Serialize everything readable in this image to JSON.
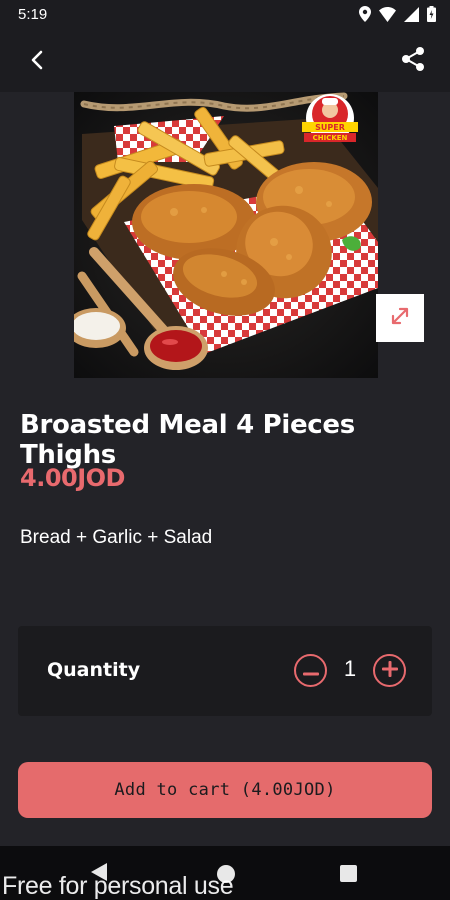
{
  "status_bar": {
    "time": "5:19"
  },
  "header": {
    "back_icon": "arrow-back-icon",
    "share_icon": "share-icon"
  },
  "product": {
    "title": "Broasted Meal 4 Pieces Thighs",
    "price": "4.00JOD",
    "description": "Bread + Garlic + Salad",
    "image_logo_text": [
      "SUPER",
      "CHICKEN"
    ],
    "expand_icon": "expand-icon"
  },
  "quantity": {
    "label": "Quantity",
    "value": "1"
  },
  "cart": {
    "button_label": "Add to cart (4.00JOD)"
  },
  "watermark": "Free for personal use",
  "colors": {
    "accent": "#e86a6e",
    "background": "#232328",
    "header": "#1c1c20",
    "card": "#1b1b1e"
  }
}
